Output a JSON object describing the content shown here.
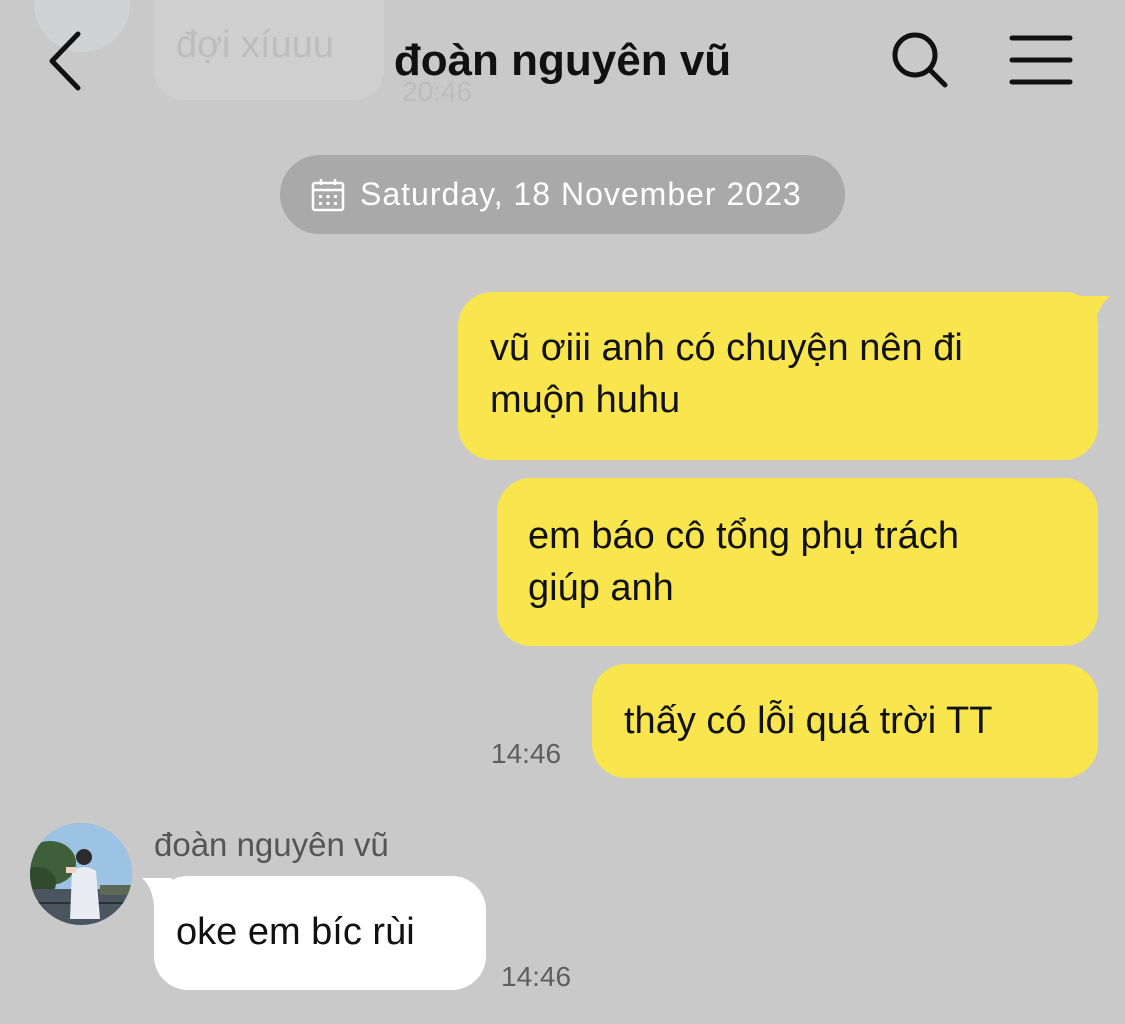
{
  "header": {
    "title": "đoàn nguyên vũ",
    "back_icon": "chevron-left-icon",
    "search_icon": "search-icon",
    "menu_icon": "hamburger-menu-icon"
  },
  "previous_message": {
    "text": "đợi xíuuu",
    "time": "20:46"
  },
  "date_separator": {
    "icon": "calendar-icon",
    "label": "Saturday, 18 November 2023"
  },
  "messages_out": [
    {
      "text_lines": [
        "vũ ơiii anh có chuyện nên đi",
        "muộn huhu"
      ]
    },
    {
      "text_lines": [
        "em báo cô tổng phụ trách",
        "giúp anh"
      ]
    },
    {
      "text_lines": [
        "thấy có lỗi quá trời TT"
      ]
    }
  ],
  "messages_out_time": "14:46",
  "message_in": {
    "sender": "đoàn nguyên vũ",
    "text": "oke em bíc rùi",
    "time": "14:46"
  },
  "colors": {
    "background": "#c9c9c9",
    "outgoing_bubble": "#f9e54e",
    "incoming_bubble": "#ffffff",
    "date_pill": "#a9a9a9"
  }
}
